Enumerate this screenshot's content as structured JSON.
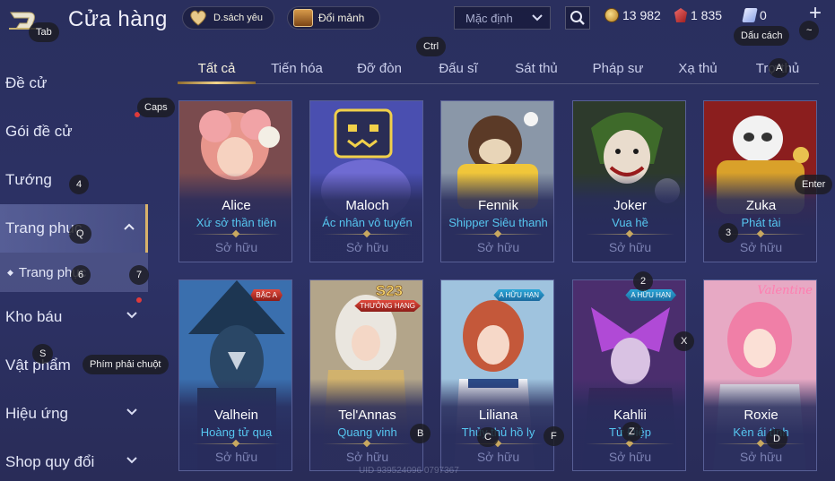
{
  "header": {
    "title": "Cửa hàng",
    "wishlist_label": "D.sách yêu",
    "fragments_label": "Đổi mảnh",
    "sort_value": "Mặc định",
    "gold": "13 982",
    "ruby": "1 835",
    "tickets": "0"
  },
  "sidebar": {
    "items": [
      {
        "label": "Đề cử"
      },
      {
        "label": "Gói đề cử"
      },
      {
        "label": "Tướng"
      },
      {
        "label": "Trang phục"
      },
      {
        "label": "Trang phục"
      },
      {
        "label": "Kho báu"
      },
      {
        "label": "Vật phẩm"
      },
      {
        "label": "Hiệu ứng"
      },
      {
        "label": "Shop quy đổi"
      }
    ]
  },
  "tabs": [
    "Tất cả",
    "Tiến hóa",
    "Đỡ đòn",
    "Đấu sĩ",
    "Sát thủ",
    "Pháp sư",
    "Xạ thủ",
    "Trợ thủ"
  ],
  "cards": [
    {
      "hero": "Alice",
      "skin": "Xứ sở thần tiên",
      "status": "Sở hữu"
    },
    {
      "hero": "Maloch",
      "skin": "Ác nhân vô tuyến",
      "status": "Sở hữu"
    },
    {
      "hero": "Fennik",
      "skin": "Shipper Siêu thanh",
      "status": "Sở hữu"
    },
    {
      "hero": "Joker",
      "skin": "Vua hề",
      "status": "Sở hữu"
    },
    {
      "hero": "Zuka",
      "skin": "Phát tài",
      "status": "Sở hữu"
    },
    {
      "hero": "Valhein",
      "skin": "Hoàng tử quạ",
      "status": "Sở hữu",
      "badge": "BẬC A"
    },
    {
      "hero": "Tel'Annas",
      "skin": "Quang vinh",
      "status": "Sở hữu",
      "badge": "THƯỞNG HẠNG",
      "tag": "S23"
    },
    {
      "hero": "Liliana",
      "skin": "Thủy thủ hồ ly",
      "status": "Sở hữu",
      "badge": "HỮU HẠN",
      "badge_head": "A"
    },
    {
      "hero": "Kahlii",
      "skin": "Tử Điệp",
      "status": "Sở hữu",
      "badge": "HỮU HẠN",
      "badge_head": "A"
    },
    {
      "hero": "Roxie",
      "skin": "Kèn ái tình",
      "status": "Sở hữu",
      "tag": "Valentine"
    }
  ],
  "uid": "UID 939524096 0797367",
  "keys": {
    "tab": "Tab",
    "ctrl": "Ctrl",
    "space": "Dấu cách",
    "tilde": "~",
    "caps": "Caps",
    "k4": "4",
    "enter": "Enter",
    "q": "Q",
    "k3": "3",
    "k6": "6",
    "k7": "7",
    "k2": "2",
    "a": "A",
    "s": "S",
    "rclick": "Phím phải chuột",
    "x": "X",
    "b": "B",
    "c": "C",
    "f": "F",
    "z": "Z",
    "d": "D"
  },
  "colors": {
    "background": "#2b3062",
    "skin_name": "#56c6f0",
    "accent_gold": "#f2d48c",
    "owned_text": "#7c82b3"
  }
}
